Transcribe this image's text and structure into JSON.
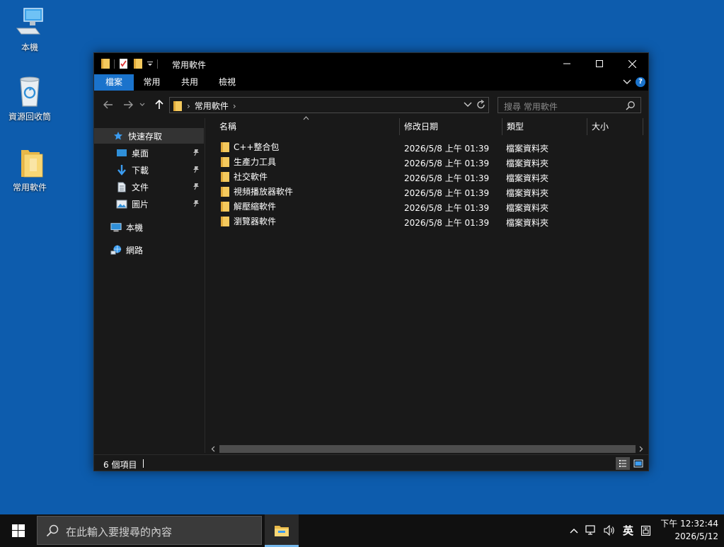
{
  "desktop": {
    "icons": [
      {
        "label": "本機"
      },
      {
        "label": "資源回收筒"
      },
      {
        "label": "常用軟件"
      }
    ]
  },
  "window": {
    "title": "常用軟件",
    "ribbon_tabs": [
      "檔案",
      "常用",
      "共用",
      "檢視"
    ],
    "address": {
      "crumb": "常用軟件"
    },
    "search_placeholder": "搜尋 常用軟件",
    "nav": {
      "quick_access": "快速存取",
      "items": [
        {
          "label": "桌面",
          "icon": "desktop-icon"
        },
        {
          "label": "下載",
          "icon": "download-icon"
        },
        {
          "label": "文件",
          "icon": "documents-icon"
        },
        {
          "label": "圖片",
          "icon": "pictures-icon"
        }
      ],
      "this_pc": "本機",
      "network": "網路"
    },
    "columns": [
      "名稱",
      "修改日期",
      "類型",
      "大小"
    ],
    "files": [
      {
        "name": "C++整合包",
        "date": "2026/5/8 上午 01:39",
        "type": "檔案資料夾"
      },
      {
        "name": "生產力工具",
        "date": "2026/5/8 上午 01:39",
        "type": "檔案資料夾"
      },
      {
        "name": "社交軟件",
        "date": "2026/5/8 上午 01:39",
        "type": "檔案資料夾"
      },
      {
        "name": "視頻播放器軟件",
        "date": "2026/5/8 上午 01:39",
        "type": "檔案資料夾"
      },
      {
        "name": "解壓縮軟件",
        "date": "2026/5/8 上午 01:39",
        "type": "檔案資料夾"
      },
      {
        "name": "瀏覽器軟件",
        "date": "2026/5/8 上午 01:39",
        "type": "檔案資料夾"
      }
    ],
    "status": "6 個項目"
  },
  "taskbar": {
    "search_placeholder": "在此輸入要搜尋的內容",
    "ime": "英",
    "time": "下午 12:32:44",
    "date": "2026/5/12"
  },
  "colors": {
    "desktop": "#0d5cad",
    "accent": "#1a73cc",
    "folder": "#f4c95d"
  }
}
